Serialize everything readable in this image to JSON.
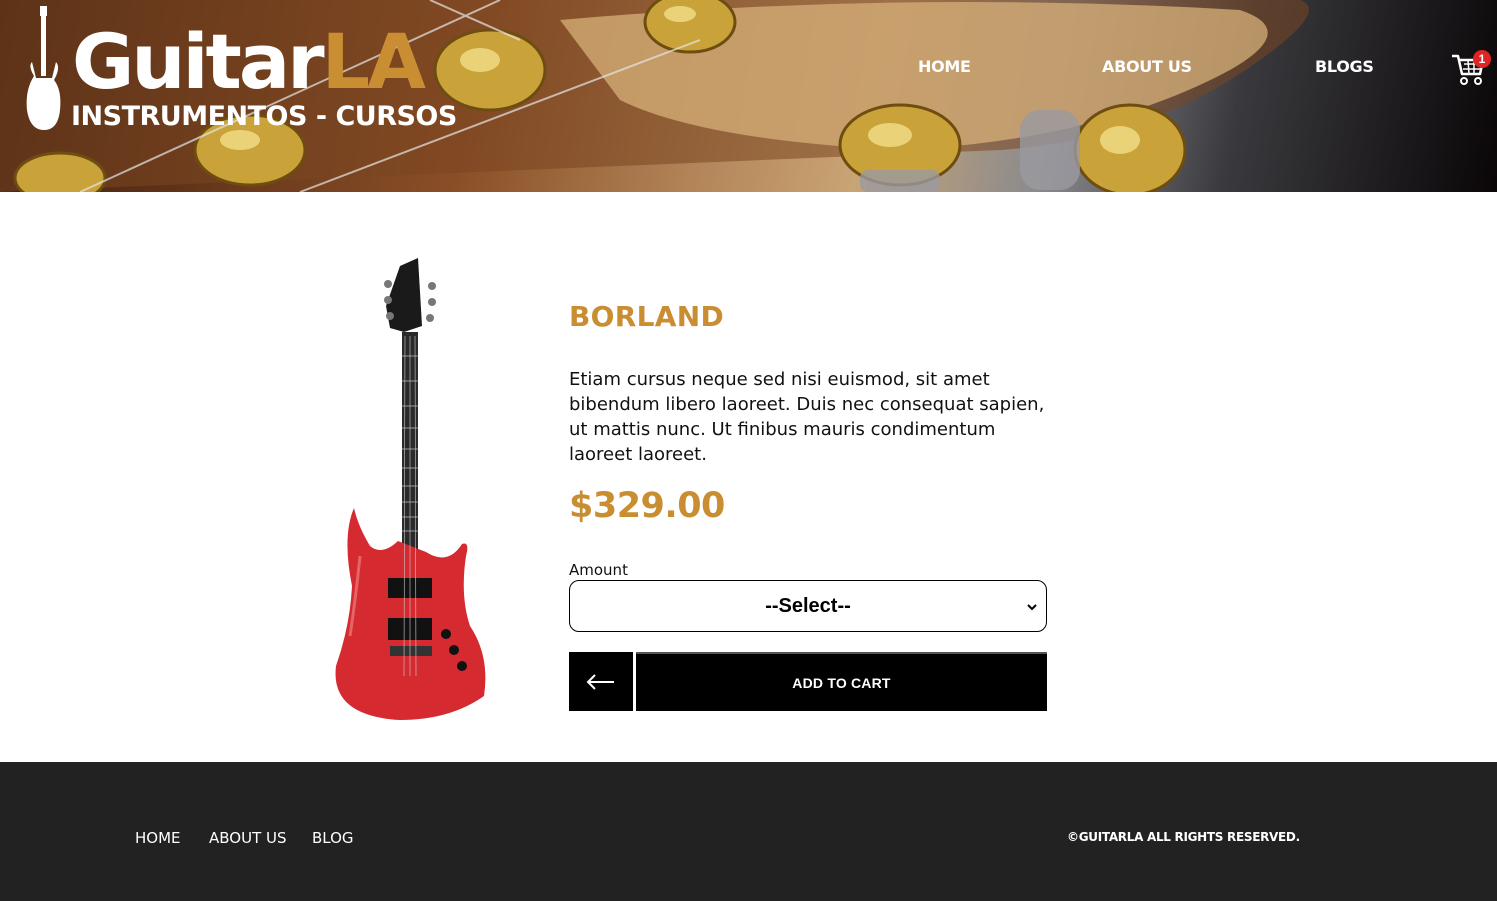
{
  "header": {
    "logo": {
      "word_main": "Guitar",
      "word_accent": "LA",
      "tagline": "INSTRUMENTOS - CURSOS"
    },
    "nav": [
      {
        "label": "HOME"
      },
      {
        "label": "ABOUT US"
      },
      {
        "label": "BLOGS"
      }
    ],
    "cart": {
      "count": "1"
    }
  },
  "product": {
    "name": "BORLAND",
    "description": "Etiam cursus neque sed nisi euismod, sit amet bibendum libero laoreet. Duis nec consequat sapien, ut mattis nunc. Ut finibus mauris condimentum laoreet laoreet.",
    "price": "$329.00",
    "amount_label": "Amount",
    "amount_selected": "--Select--",
    "add_to_cart_label": "ADD TO CART"
  },
  "footer": {
    "nav": [
      {
        "label": "HOME"
      },
      {
        "label": "ABOUT US"
      },
      {
        "label": "BLOG"
      }
    ],
    "copyright": "©GUITARLA ALL RIGHTS RESERVED."
  },
  "colors": {
    "accent": "#c98d32",
    "button": "#000000",
    "footer_bg": "#222222",
    "badge": "#e02424"
  }
}
